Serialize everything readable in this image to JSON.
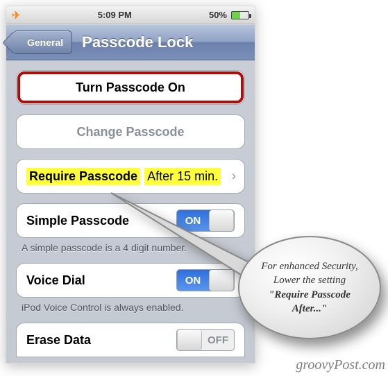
{
  "status": {
    "time": "5:09 PM",
    "battery_pct": "50%",
    "airplane_icon": "airplane-icon"
  },
  "nav": {
    "back_label": "General",
    "title": "Passcode Lock"
  },
  "rows": {
    "turn_on": "Turn Passcode On",
    "change": "Change Passcode",
    "require_label": "Require Passcode",
    "require_value": "After 15 min.",
    "simple_label": "Simple Passcode",
    "simple_toggle": "ON",
    "simple_footer": "A simple passcode is a 4 digit number.",
    "voice_label": "Voice Dial",
    "voice_toggle": "ON",
    "voice_footer": "iPod Voice Control is always enabled.",
    "erase_label": "Erase Data",
    "erase_toggle": "OFF"
  },
  "callout": {
    "line1": "For enhanced Security, Lower the setting ",
    "bold": "\"Require Passcode After...\""
  },
  "watermark": "groovyPost.com"
}
